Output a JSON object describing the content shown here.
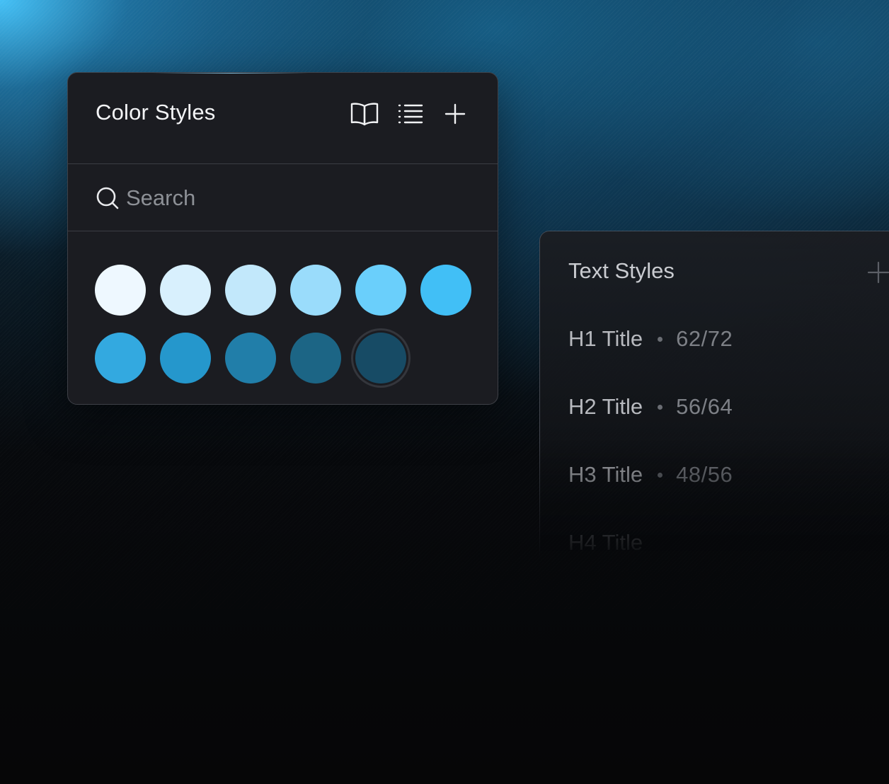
{
  "color_styles": {
    "title": "Color Styles",
    "actions": [
      {
        "name": "book-icon",
        "label": "Library"
      },
      {
        "name": "list-icon",
        "label": "List view"
      },
      {
        "name": "plus-icon",
        "label": "Add color style"
      }
    ],
    "search": {
      "placeholder": "Search",
      "value": ""
    },
    "swatches": [
      {
        "color": "#eef8ff",
        "selected": false
      },
      {
        "color": "#d8f0fd",
        "selected": false
      },
      {
        "color": "#c2e8fb",
        "selected": false
      },
      {
        "color": "#9adcfb",
        "selected": false
      },
      {
        "color": "#6acffb",
        "selected": false
      },
      {
        "color": "#41bff6",
        "selected": false
      },
      {
        "color": "#33a9e0",
        "selected": false
      },
      {
        "color": "#2597cc",
        "selected": false
      },
      {
        "color": "#217ea9",
        "selected": false
      },
      {
        "color": "#1c6585",
        "selected": false
      },
      {
        "color": "#174b65",
        "selected": true
      }
    ]
  },
  "text_styles": {
    "title": "Text Styles",
    "items": [
      {
        "name": "H1 Title",
        "size": "62/72"
      },
      {
        "name": "H2 Title",
        "size": "56/64"
      },
      {
        "name": "H3 Title",
        "size": "48/56"
      },
      {
        "name": "H4 Title",
        "size": ""
      }
    ]
  }
}
